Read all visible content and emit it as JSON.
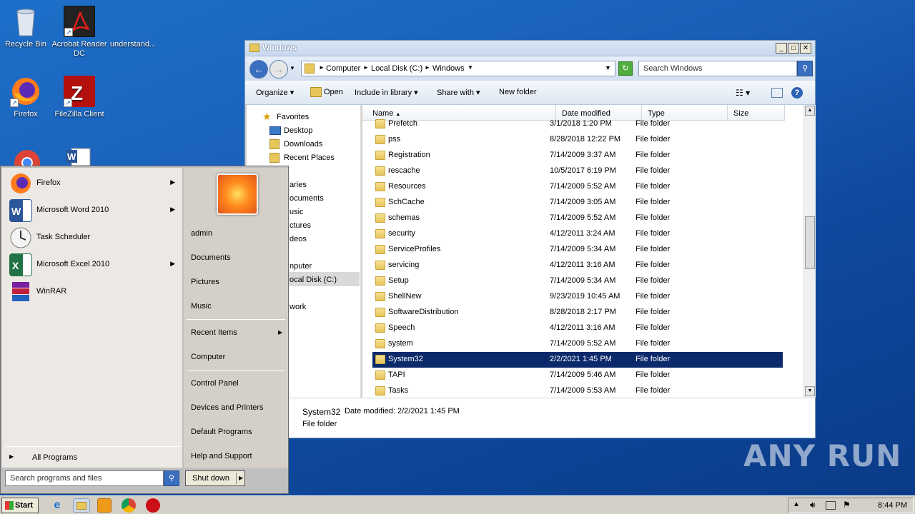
{
  "desktop": {
    "icons": [
      {
        "label": "Recycle Bin"
      },
      {
        "label": "Acrobat Reader DC"
      },
      {
        "label": "understand..."
      },
      {
        "label": "Firefox"
      },
      {
        "label": "FileZilla Client"
      }
    ]
  },
  "explorer": {
    "title": "Windows",
    "breadcrumb": [
      "Computer",
      "Local Disk (C:)",
      "Windows"
    ],
    "search_placeholder": "Search Windows",
    "toolbar": {
      "organize": "Organize",
      "open": "Open",
      "include": "Include in library",
      "share": "Share with",
      "new_folder": "New folder"
    },
    "nav": {
      "favorites": "Favorites",
      "desktop": "Desktop",
      "downloads": "Downloads",
      "recent": "Recent Places",
      "libraries_partial": "aries",
      "documents_partial": "ocuments",
      "music_partial": "usic",
      "pictures_partial": "ctures",
      "videos_partial": "deos",
      "computer_partial": "nputer",
      "localdisk_partial": "ocal Disk (C:)",
      "network_partial": "work"
    },
    "columns": [
      "Name",
      "Date modified",
      "Type",
      "Size"
    ],
    "rows": [
      {
        "name": "Prefetch",
        "date": "3/1/2018 1:20 PM",
        "type": "File folder"
      },
      {
        "name": "pss",
        "date": "8/28/2018 12:22 PM",
        "type": "File folder"
      },
      {
        "name": "Registration",
        "date": "7/14/2009 3:37 AM",
        "type": "File folder"
      },
      {
        "name": "rescache",
        "date": "10/5/2017 6:19 PM",
        "type": "File folder"
      },
      {
        "name": "Resources",
        "date": "7/14/2009 5:52 AM",
        "type": "File folder"
      },
      {
        "name": "SchCache",
        "date": "7/14/2009 3:05 AM",
        "type": "File folder"
      },
      {
        "name": "schemas",
        "date": "7/14/2009 5:52 AM",
        "type": "File folder"
      },
      {
        "name": "security",
        "date": "4/12/2011 3:24 AM",
        "type": "File folder"
      },
      {
        "name": "ServiceProfiles",
        "date": "7/14/2009 5:34 AM",
        "type": "File folder"
      },
      {
        "name": "servicing",
        "date": "4/12/2011 3:16 AM",
        "type": "File folder"
      },
      {
        "name": "Setup",
        "date": "7/14/2009 5:34 AM",
        "type": "File folder"
      },
      {
        "name": "ShellNew",
        "date": "9/23/2019 10:45 AM",
        "type": "File folder"
      },
      {
        "name": "SoftwareDistribution",
        "date": "8/28/2018 2:17 PM",
        "type": "File folder"
      },
      {
        "name": "Speech",
        "date": "4/12/2011 3:16 AM",
        "type": "File folder"
      },
      {
        "name": "system",
        "date": "7/14/2009 5:52 AM",
        "type": "File folder"
      },
      {
        "name": "System32",
        "date": "2/2/2021 1:45 PM",
        "type": "File folder"
      },
      {
        "name": "TAPI",
        "date": "7/14/2009 5:46 AM",
        "type": "File folder"
      },
      {
        "name": "Tasks",
        "date": "7/14/2009 5:53 AM",
        "type": "File folder"
      }
    ],
    "details": {
      "name": "System32",
      "date_label": "Date modified:",
      "date": "2/2/2021 1:45 PM",
      "type": "File folder"
    }
  },
  "start_menu": {
    "programs": [
      {
        "label": "Firefox"
      },
      {
        "label": "Microsoft Word 2010"
      },
      {
        "label": "Task Scheduler"
      },
      {
        "label": "Microsoft Excel 2010"
      },
      {
        "label": "WinRAR"
      }
    ],
    "all_programs": "All Programs",
    "search_placeholder": "Search programs and files",
    "right": {
      "user": "admin",
      "documents": "Documents",
      "pictures": "Pictures",
      "music": "Music",
      "recent": "Recent Items",
      "computer": "Computer",
      "control": "Control Panel",
      "devices": "Devices and Printers",
      "defaults": "Default Programs",
      "help": "Help and Support"
    },
    "shutdown": "Shut down"
  },
  "taskbar": {
    "start": "Start",
    "clock": "8:44 PM"
  },
  "watermark": "ANY RUN"
}
